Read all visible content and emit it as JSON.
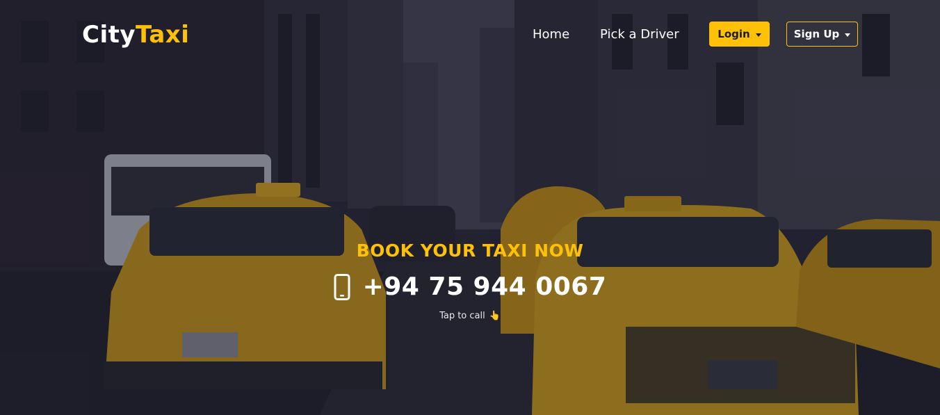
{
  "brand": {
    "part1": "City",
    "part2": "Taxi"
  },
  "nav": {
    "home": "Home",
    "pick_driver": "Pick a Driver",
    "login": "Login",
    "signup": "Sign Up"
  },
  "hero": {
    "headline": "BOOK YOUR TAXI NOW",
    "phone": "+94 75 944 0067",
    "tap_text": "Tap to call",
    "tap_emoji": "👆",
    "background": "city-street-with-yellow-taxis-image"
  },
  "colors": {
    "accent": "#ffc107",
    "text": "#ffffff",
    "overlay": "#1e1e32"
  }
}
